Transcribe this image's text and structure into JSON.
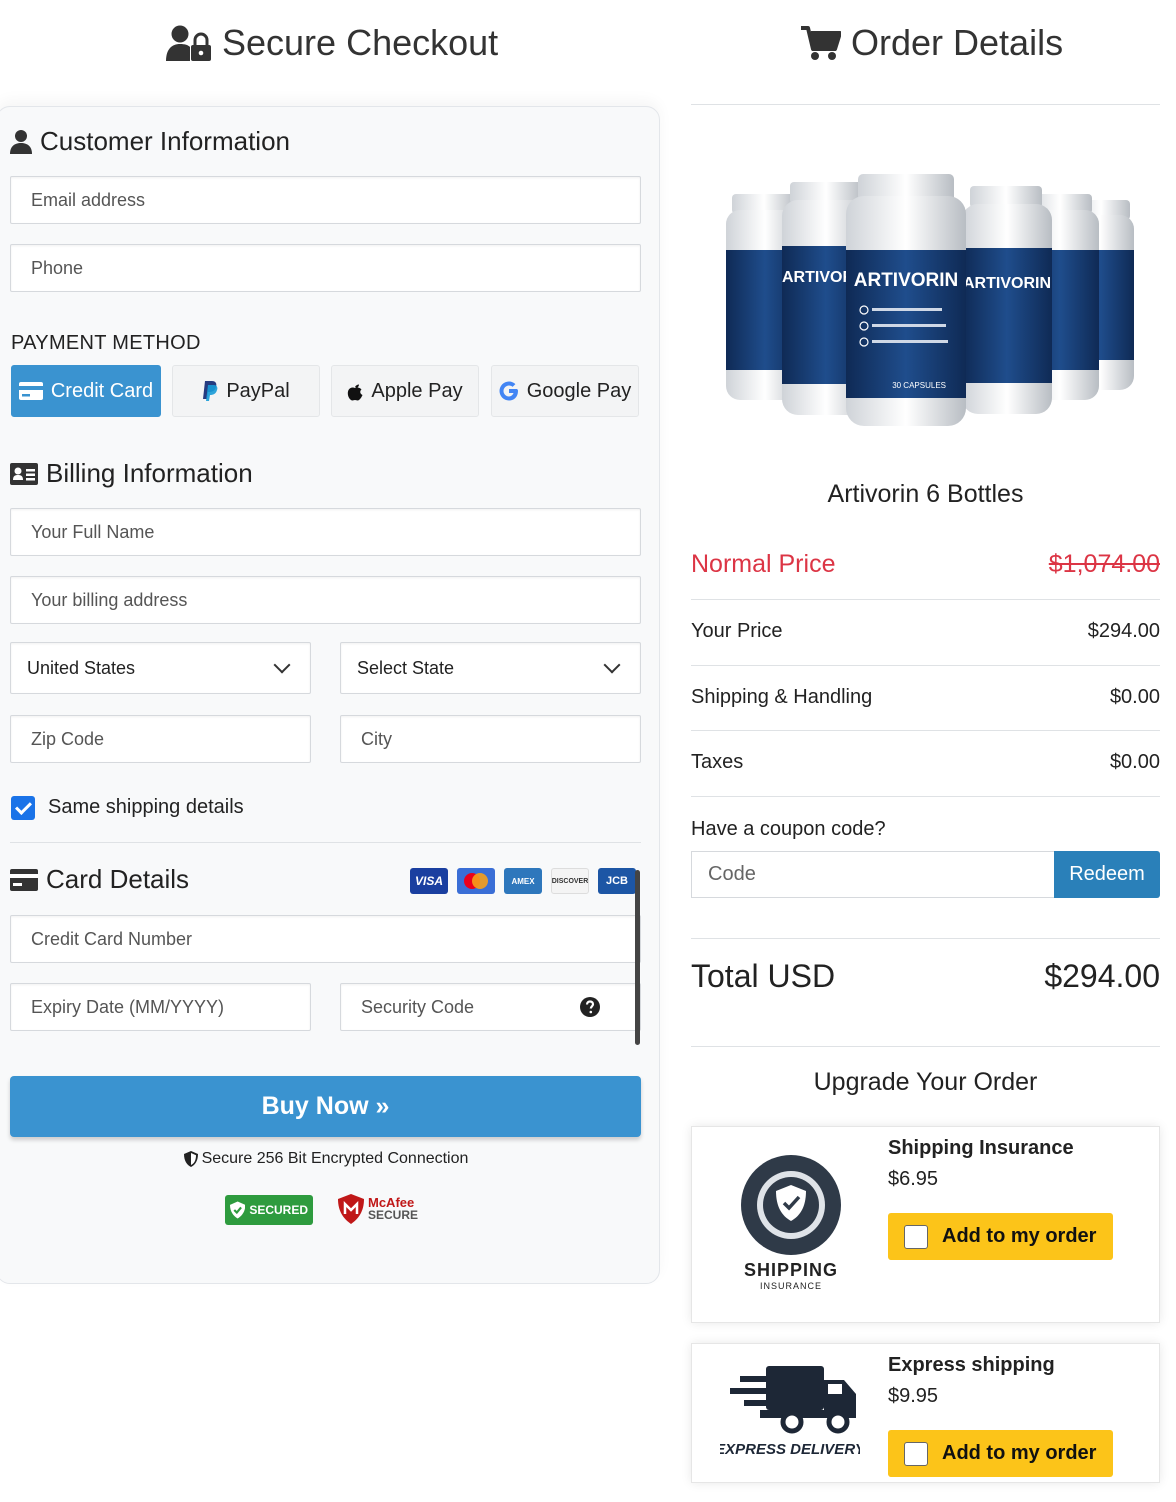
{
  "headers": {
    "left": "Secure Checkout",
    "right": "Order Details"
  },
  "customer": {
    "title": "Customer Information",
    "email_placeholder": "Email address",
    "phone_placeholder": "Phone"
  },
  "payment": {
    "label": "PAYMENT METHOD",
    "methods": [
      "Credit Card",
      "PayPal",
      "Apple Pay",
      "Google Pay"
    ],
    "active": "Credit Card"
  },
  "billing": {
    "title": "Billing Information",
    "name_placeholder": "Your Full Name",
    "address_placeholder": "Your billing address",
    "country": "United States",
    "state": "Select State",
    "zip_placeholder": "Zip Code",
    "city_placeholder": "City",
    "same_shipping_label": "Same shipping details",
    "same_shipping_checked": true
  },
  "card": {
    "title": "Card Details",
    "logos": [
      "VISA",
      "Mastercard",
      "AMEX",
      "DISCOVER",
      "JCB"
    ],
    "number_placeholder": "Credit Card Number",
    "expiry_placeholder": "Expiry Date (MM/YYYY)",
    "cvv_placeholder": "Security Code"
  },
  "buy": {
    "label": "Buy Now »",
    "secure_text": "Secure 256 Bit Encrypted Connection",
    "badge_secured": "SECURED",
    "badge_mcafee_1": "McAfee",
    "badge_mcafee_2": "SECURE"
  },
  "order": {
    "product_name": "Artivorin 6 Bottles",
    "bottle_brand": "ARTIVORIN",
    "bottle_sub": "30 CAPSULES",
    "normal_price_label": "Normal Price",
    "normal_price": "$1,074.00",
    "your_price_label": "Your Price",
    "your_price": "$294.00",
    "shipping_label": "Shipping & Handling",
    "shipping": "$0.00",
    "taxes_label": "Taxes",
    "taxes": "$0.00",
    "coupon_label": "Have a coupon code?",
    "coupon_placeholder": "Code",
    "redeem_label": "Redeem",
    "total_label": "Total USD",
    "total": "$294.00"
  },
  "upgrades": {
    "title": "Upgrade Your Order",
    "items": [
      {
        "name": "Shipping Insurance",
        "price": "$6.95",
        "button": "Add to my order",
        "logo_text": "SHIPPING",
        "logo_sub": "INSURANCE"
      },
      {
        "name": "Express shipping",
        "price": "$9.95",
        "button": "Add to my order",
        "logo_text": "EXPRESS DELIVERY"
      }
    ]
  },
  "colors": {
    "primary_blue": "#3a93d0",
    "redeem_blue": "#2a80b9",
    "normal_price_red": "#dc3545",
    "add_yellow": "#fcc419"
  }
}
